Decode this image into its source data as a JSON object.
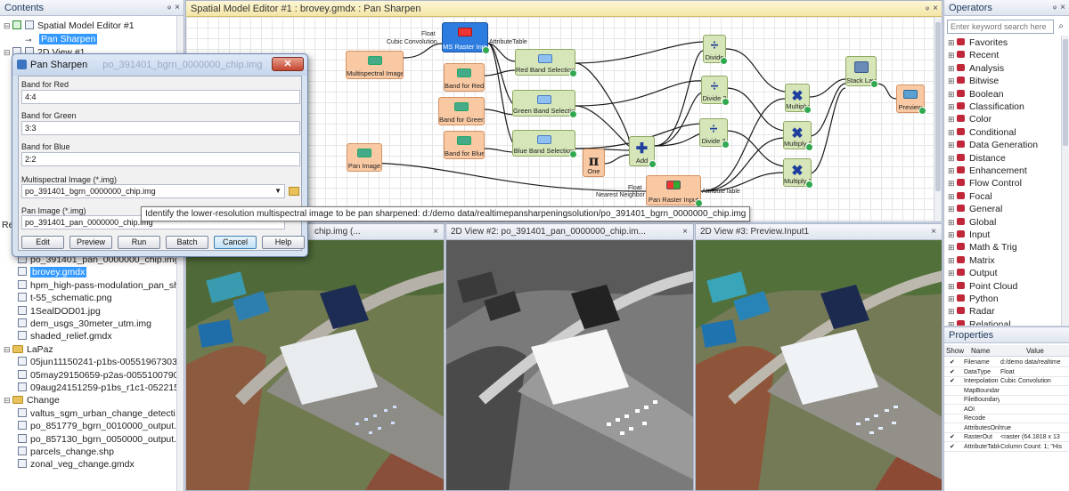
{
  "contents": {
    "title": "Contents",
    "items": [
      {
        "label": "Spatial Model Editor #1",
        "indent": 0,
        "kind": "editor"
      },
      {
        "label": "Pan Sharpen",
        "indent": 1,
        "kind": "model",
        "selected": true
      },
      {
        "label": "2D View #1",
        "indent": 0,
        "kind": "view"
      }
    ],
    "lower_items": [
      {
        "label": "po_391401_pan_0000000_chip.img",
        "indent": 2,
        "kind": "file"
      },
      {
        "label": "brovey.gmdx",
        "indent": 2,
        "kind": "file",
        "selected": true
      },
      {
        "label": "hpm_high-pass-modulation_pan_sh",
        "indent": 2,
        "kind": "file"
      },
      {
        "label": "t-55_schematic.png",
        "indent": 2,
        "kind": "file"
      },
      {
        "label": "1SealDOD01.jpg",
        "indent": 2,
        "kind": "file"
      },
      {
        "label": "dem_usgs_30meter_utm.img",
        "indent": 2,
        "kind": "file"
      },
      {
        "label": "shaded_relief.gmdx",
        "indent": 2,
        "kind": "file"
      },
      {
        "label": "LaPaz",
        "indent": 0,
        "kind": "folder"
      },
      {
        "label": "05jun11150241-p1bs-00551967303",
        "indent": 2,
        "kind": "file"
      },
      {
        "label": "05may29150659-p2as-0055100790",
        "indent": 2,
        "kind": "file"
      },
      {
        "label": "09aug24151259-p1bs_r1c1-052215",
        "indent": 2,
        "kind": "file"
      },
      {
        "label": "Change",
        "indent": 0,
        "kind": "folder"
      },
      {
        "label": "valtus_sgm_urban_change_detecti",
        "indent": 2,
        "kind": "file"
      },
      {
        "label": "po_851779_bgrn_0010000_output.i",
        "indent": 2,
        "kind": "file"
      },
      {
        "label": "po_857130_bgrn_0050000_output.i",
        "indent": 2,
        "kind": "file"
      },
      {
        "label": "parcels_change.shp",
        "indent": 2,
        "kind": "file"
      },
      {
        "label": "zonal_veg_change.gmdx",
        "indent": 2,
        "kind": "file"
      }
    ],
    "partial_label": "Re"
  },
  "editor": {
    "title": "Spatial Model Editor #1 : brovey.gmdx : Pan Sharpen",
    "nodes": {
      "ms_raster_input": "MS Raster Input",
      "multispectral_image": "Multispectral Image",
      "band_for_red": "Band for Red",
      "band_for_green": "Band for Green",
      "band_for_blue": "Band for Blue",
      "pan_image": "Pan Image",
      "red_band_selection": "Red Band Selection",
      "green_band_selection": "Green Band Selection",
      "blue_band_selection": "Blue Band Selection",
      "one": "One",
      "add": "Add",
      "divide": "Divide",
      "divide_2": "Divide 2",
      "divide_3": "Divide 3",
      "multiply": "Multiply",
      "multiply_2": "Multiply 2",
      "multiply_3": "Multiply 3",
      "stack_layers": "Stack Layers",
      "preview": "Preview",
      "pan_raster_input": "Pan Raster Input"
    },
    "edge_labels": {
      "float_top": "Float",
      "cubic_convolution": "Cubic Convolution",
      "attribute_table_top": "AttributeTable",
      "float_bottom": "Float",
      "nearest_neighbor": "Nearest Neighbor",
      "attribute_table_bottom": "AttributeTable"
    },
    "pi_symbol": "π"
  },
  "operators": {
    "title": "Operators",
    "search_placeholder": "Enter keyword search here",
    "items": [
      "Favorites",
      "Recent",
      "Analysis",
      "Bitwise",
      "Boolean",
      "Classification",
      "Color",
      "Conditional",
      "Data Generation",
      "Distance",
      "Enhancement",
      "Flow Control",
      "Focal",
      "General",
      "Global",
      "Input",
      "Math & Trig",
      "Matrix",
      "Output",
      "Point Cloud",
      "Python",
      "Radar",
      "Relational"
    ]
  },
  "properties": {
    "title": "Properties",
    "headers": {
      "show": "Show",
      "name": "Name",
      "value": "Value"
    },
    "rows": [
      {
        "checked": true,
        "name": "Filename",
        "value": "d:/demo data/realtime"
      },
      {
        "checked": true,
        "name": "DataType",
        "value": "Float"
      },
      {
        "checked": true,
        "name": "Interpolation",
        "value": "Cubic Convolution"
      },
      {
        "checked": false,
        "name": "MapBoundary",
        "value": ""
      },
      {
        "checked": false,
        "name": "FileBoundary",
        "value": ""
      },
      {
        "checked": false,
        "name": "AOI",
        "value": ""
      },
      {
        "checked": false,
        "name": "Recode",
        "value": ""
      },
      {
        "checked": false,
        "name": "AttributesOnly",
        "value": "true"
      },
      {
        "checked": true,
        "name": "RasterOut",
        "value": "<raster (64.1818 x 13"
      },
      {
        "checked": true,
        "name": "AttributeTable",
        "value": "Column Count: 1; \"His"
      }
    ]
  },
  "views": {
    "view1": "2D View #1: po_391401_bgrn_0000000_chip.img (...",
    "view1_visible": "chip.img (...",
    "view2": "2D View #2: po_391401_pan_0000000_chip.im...",
    "view3": "2D View #3: Preview.Input1"
  },
  "dialog": {
    "title": "Pan Sharpen",
    "title_overflow": "po_391401_bgrn_0000000_chip.img",
    "close_glyph": "✕",
    "band_red_label": "Band for Red",
    "band_red_value": "4:4",
    "band_green_label": "Band for Green",
    "band_green_value": "3:3",
    "band_blue_label": "Band for Blue",
    "band_blue_value": "2:2",
    "ms_image_label": "Multispectral Image (*.img)",
    "ms_image_value": "po_391401_bgrn_0000000_chip.img",
    "pan_image_label": "Pan Image (*.img)",
    "pan_image_value": "po_391401_pan_0000000_chip.img",
    "buttons": {
      "edit": "Edit",
      "preview": "Preview",
      "run": "Run",
      "batch": "Batch",
      "cancel": "Cancel",
      "help": "Help"
    }
  },
  "tooltip": "Identify the lower-resolution multispectral image to be pan sharpened: d:/demo data/realtimepansharpeningsolution/po_391401_bgrn_0000000_chip.img",
  "glyphs": {
    "pin": "ᵠ",
    "close": "×",
    "expand": "⊞",
    "collapse": "⊟",
    "search": "🔍",
    "dropdown": "▼"
  },
  "colors": {
    "input_node": "#f9c9a4",
    "operator_node": "#d7e6b8",
    "selected_node": "#2d7de0",
    "check": "#2fa84f"
  }
}
